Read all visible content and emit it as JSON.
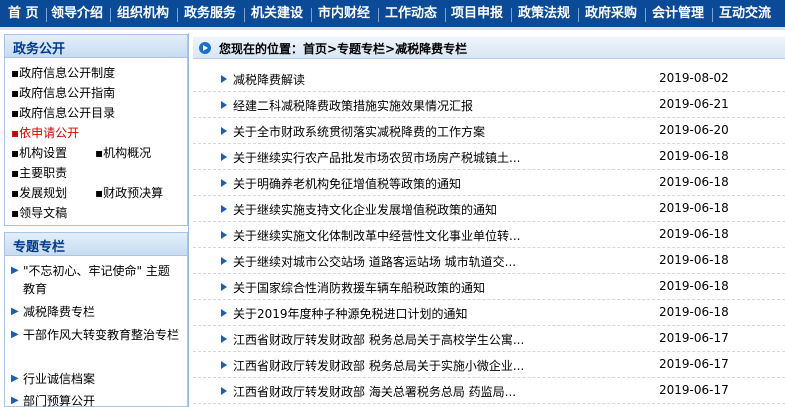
{
  "nav": {
    "items": [
      "首  页",
      "领导介绍",
      "组织机构",
      "政务服务",
      "机关建设",
      "市内财经",
      "工作动态",
      "项目申报",
      "政策法规",
      "政府采购",
      "会计管理",
      "互动交流"
    ]
  },
  "sidebar": {
    "gov_title": "政务公开",
    "gov_links": [
      "▪政府信息公开制度",
      "▪政府信息公开指南",
      "▪政府信息公开目录",
      "▪依申请公开",
      "▪机构设置",
      "▪机构概况",
      "▪主要职责",
      "▪发展规划",
      "▪财政预决算",
      "▪领导文稿"
    ],
    "topic_title": "专题专栏",
    "topics": [
      "\"不忘初心、牢记使命\" 主题教育",
      "减税降费专栏",
      "干部作风大转变教育整治专栏",
      "行业诚信档案",
      "部门预算公开"
    ]
  },
  "breadcrumb": {
    "text": "您现在的位置：首页>专题专栏>减税降费专栏"
  },
  "articles": [
    {
      "title": "减税降费解读",
      "date": "2019-08-02"
    },
    {
      "title": "经建二科减税降费政策措施实施效果情况汇报",
      "date": "2019-06-21"
    },
    {
      "title": "关于全市财政系统贯彻落实减税降费的工作方案",
      "date": "2019-06-20"
    },
    {
      "title": "关于继续实行农产品批发市场农贸市场房产税城镇土...",
      "date": "2019-06-18"
    },
    {
      "title": "关于明确养老机构免征增值税等政策的通知",
      "date": "2019-06-18"
    },
    {
      "title": "关于继续实施支持文化企业发展增值税政策的通知",
      "date": "2019-06-18"
    },
    {
      "title": "关于继续实施文化体制改革中经营性文化事业单位转...",
      "date": "2019-06-18"
    },
    {
      "title": "关于继续对城市公交站场 道路客运站场 城市轨道交...",
      "date": "2019-06-18"
    },
    {
      "title": "关于国家综合性消防救援车辆车船税政策的通知",
      "date": "2019-06-18"
    },
    {
      "title": "关于2019年度种子种源免税进口计划的通知",
      "date": "2019-06-18"
    },
    {
      "title": "江西省财政厅转发财政部 税务总局关于高校学生公寓...",
      "date": "2019-06-17"
    },
    {
      "title": "江西省财政厅转发财政部 税务总局关于实施小微企业...",
      "date": "2019-06-17"
    },
    {
      "title": "江西省财政厅转发财政部 海关总署税务总局 药监局...",
      "date": "2019-06-17"
    }
  ],
  "colors": {
    "nav_bg": "#0a4a96",
    "link_active": "#d40000",
    "bullet": "#1a5fb4"
  },
  "icons": {
    "breadcrumb": "play-circle-icon",
    "row_bullet": "triangle-right-icon",
    "topic_bullet": "triangle-right-icon"
  }
}
